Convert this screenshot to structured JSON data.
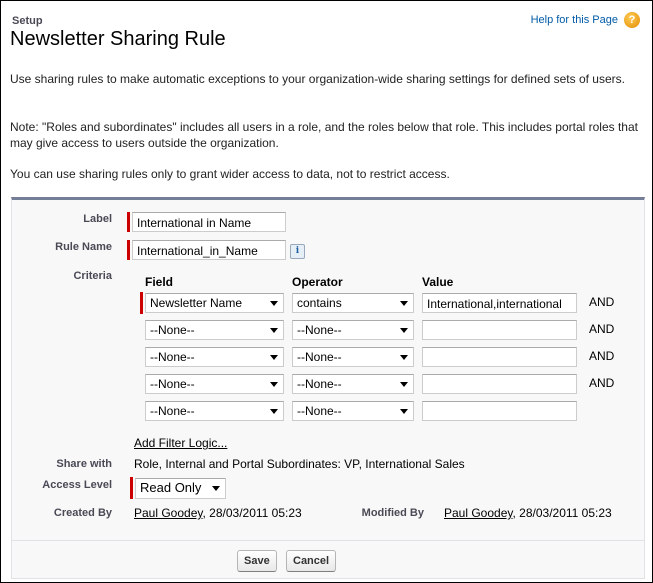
{
  "header": {
    "breadcrumb": "Setup",
    "title": "Newsletter Sharing Rule",
    "help_link": "Help for this Page",
    "help_icon": "question-mark-icon"
  },
  "intro": {
    "p1": "Use sharing rules to make automatic exceptions to your organization-wide sharing settings for defined sets of users.",
    "p2": "Note: \"Roles and subordinates\" includes all users in a role, and the roles below that role. This includes portal roles that may give access to users outside the organization.",
    "p3": "You can use sharing rules only to grant wider access to data, not to restrict access."
  },
  "form": {
    "label_label": "Label",
    "label_value": "International in Name",
    "rule_name_label": "Rule Name",
    "rule_name_value": "International_in_Name",
    "info_icon": "i",
    "criteria_label": "Criteria",
    "criteria_headers": {
      "field": "Field",
      "operator": "Operator",
      "value": "Value"
    },
    "criteria_rows": [
      {
        "field": "Newsletter Name",
        "operator": "contains",
        "value": "International,international",
        "conjunction": "AND"
      },
      {
        "field": "--None--",
        "operator": "--None--",
        "value": "",
        "conjunction": "AND"
      },
      {
        "field": "--None--",
        "operator": "--None--",
        "value": "",
        "conjunction": "AND"
      },
      {
        "field": "--None--",
        "operator": "--None--",
        "value": "",
        "conjunction": "AND"
      },
      {
        "field": "--None--",
        "operator": "--None--",
        "value": "",
        "conjunction": ""
      }
    ],
    "add_filter_logic": "Add Filter Logic...",
    "share_with_label": "Share with",
    "share_with_value": "Role, Internal and Portal Subordinates: VP, International Sales",
    "access_level_label": "Access Level",
    "access_level_value": "Read Only",
    "created_by_label": "Created By",
    "created_by_user": "Paul Goodey",
    "created_by_date": ", 28/03/2011 05:23",
    "modified_by_label": "Modified By",
    "modified_by_user": "Paul Goodey",
    "modified_by_date": ", 28/03/2011 05:23"
  },
  "buttons": {
    "save": "Save",
    "cancel": "Cancel"
  }
}
